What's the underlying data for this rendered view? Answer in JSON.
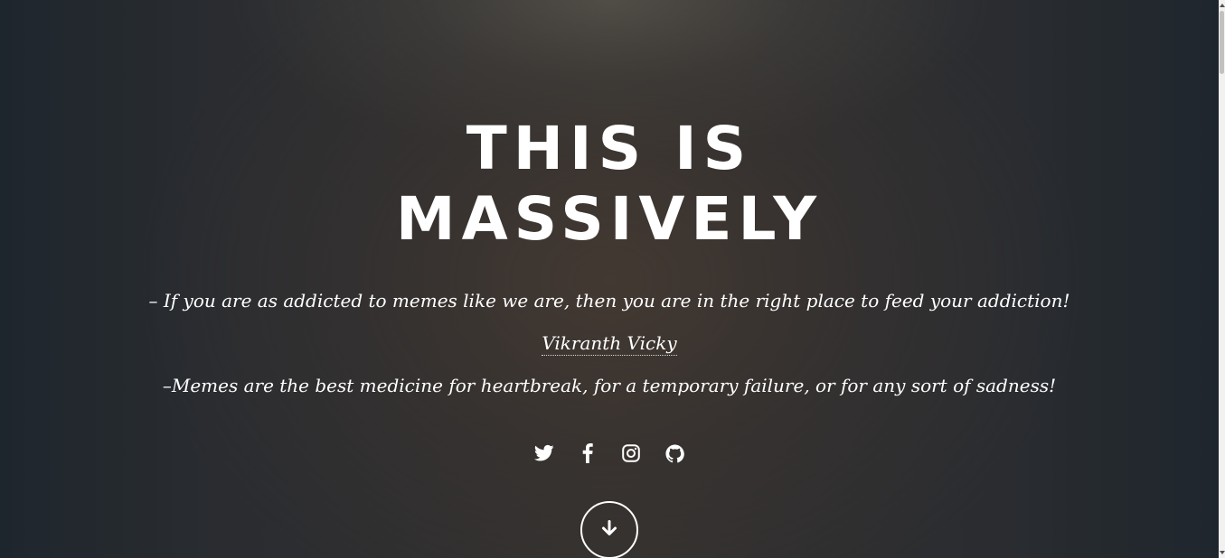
{
  "header": {
    "title_line1": "THIS IS",
    "title_line2": "MASSIVELY"
  },
  "quotes": {
    "first": "– If you are as addicted to memes like we are, then you are in the right place to feed your addiction!",
    "author": "Vikranth Vicky",
    "second": "–Memes are the best medicine for heartbreak, for a temporary failure, or for any sort of sadness!"
  },
  "social_links": [
    {
      "icon": "twitter-icon"
    },
    {
      "icon": "facebook-icon"
    },
    {
      "icon": "instagram-icon"
    },
    {
      "icon": "github-icon"
    }
  ],
  "scroll_button": {
    "icon": "arrow-down-icon"
  },
  "colors": {
    "text": "#ffffff",
    "background_edge": "#1e262d",
    "background_center": "#35322f"
  }
}
